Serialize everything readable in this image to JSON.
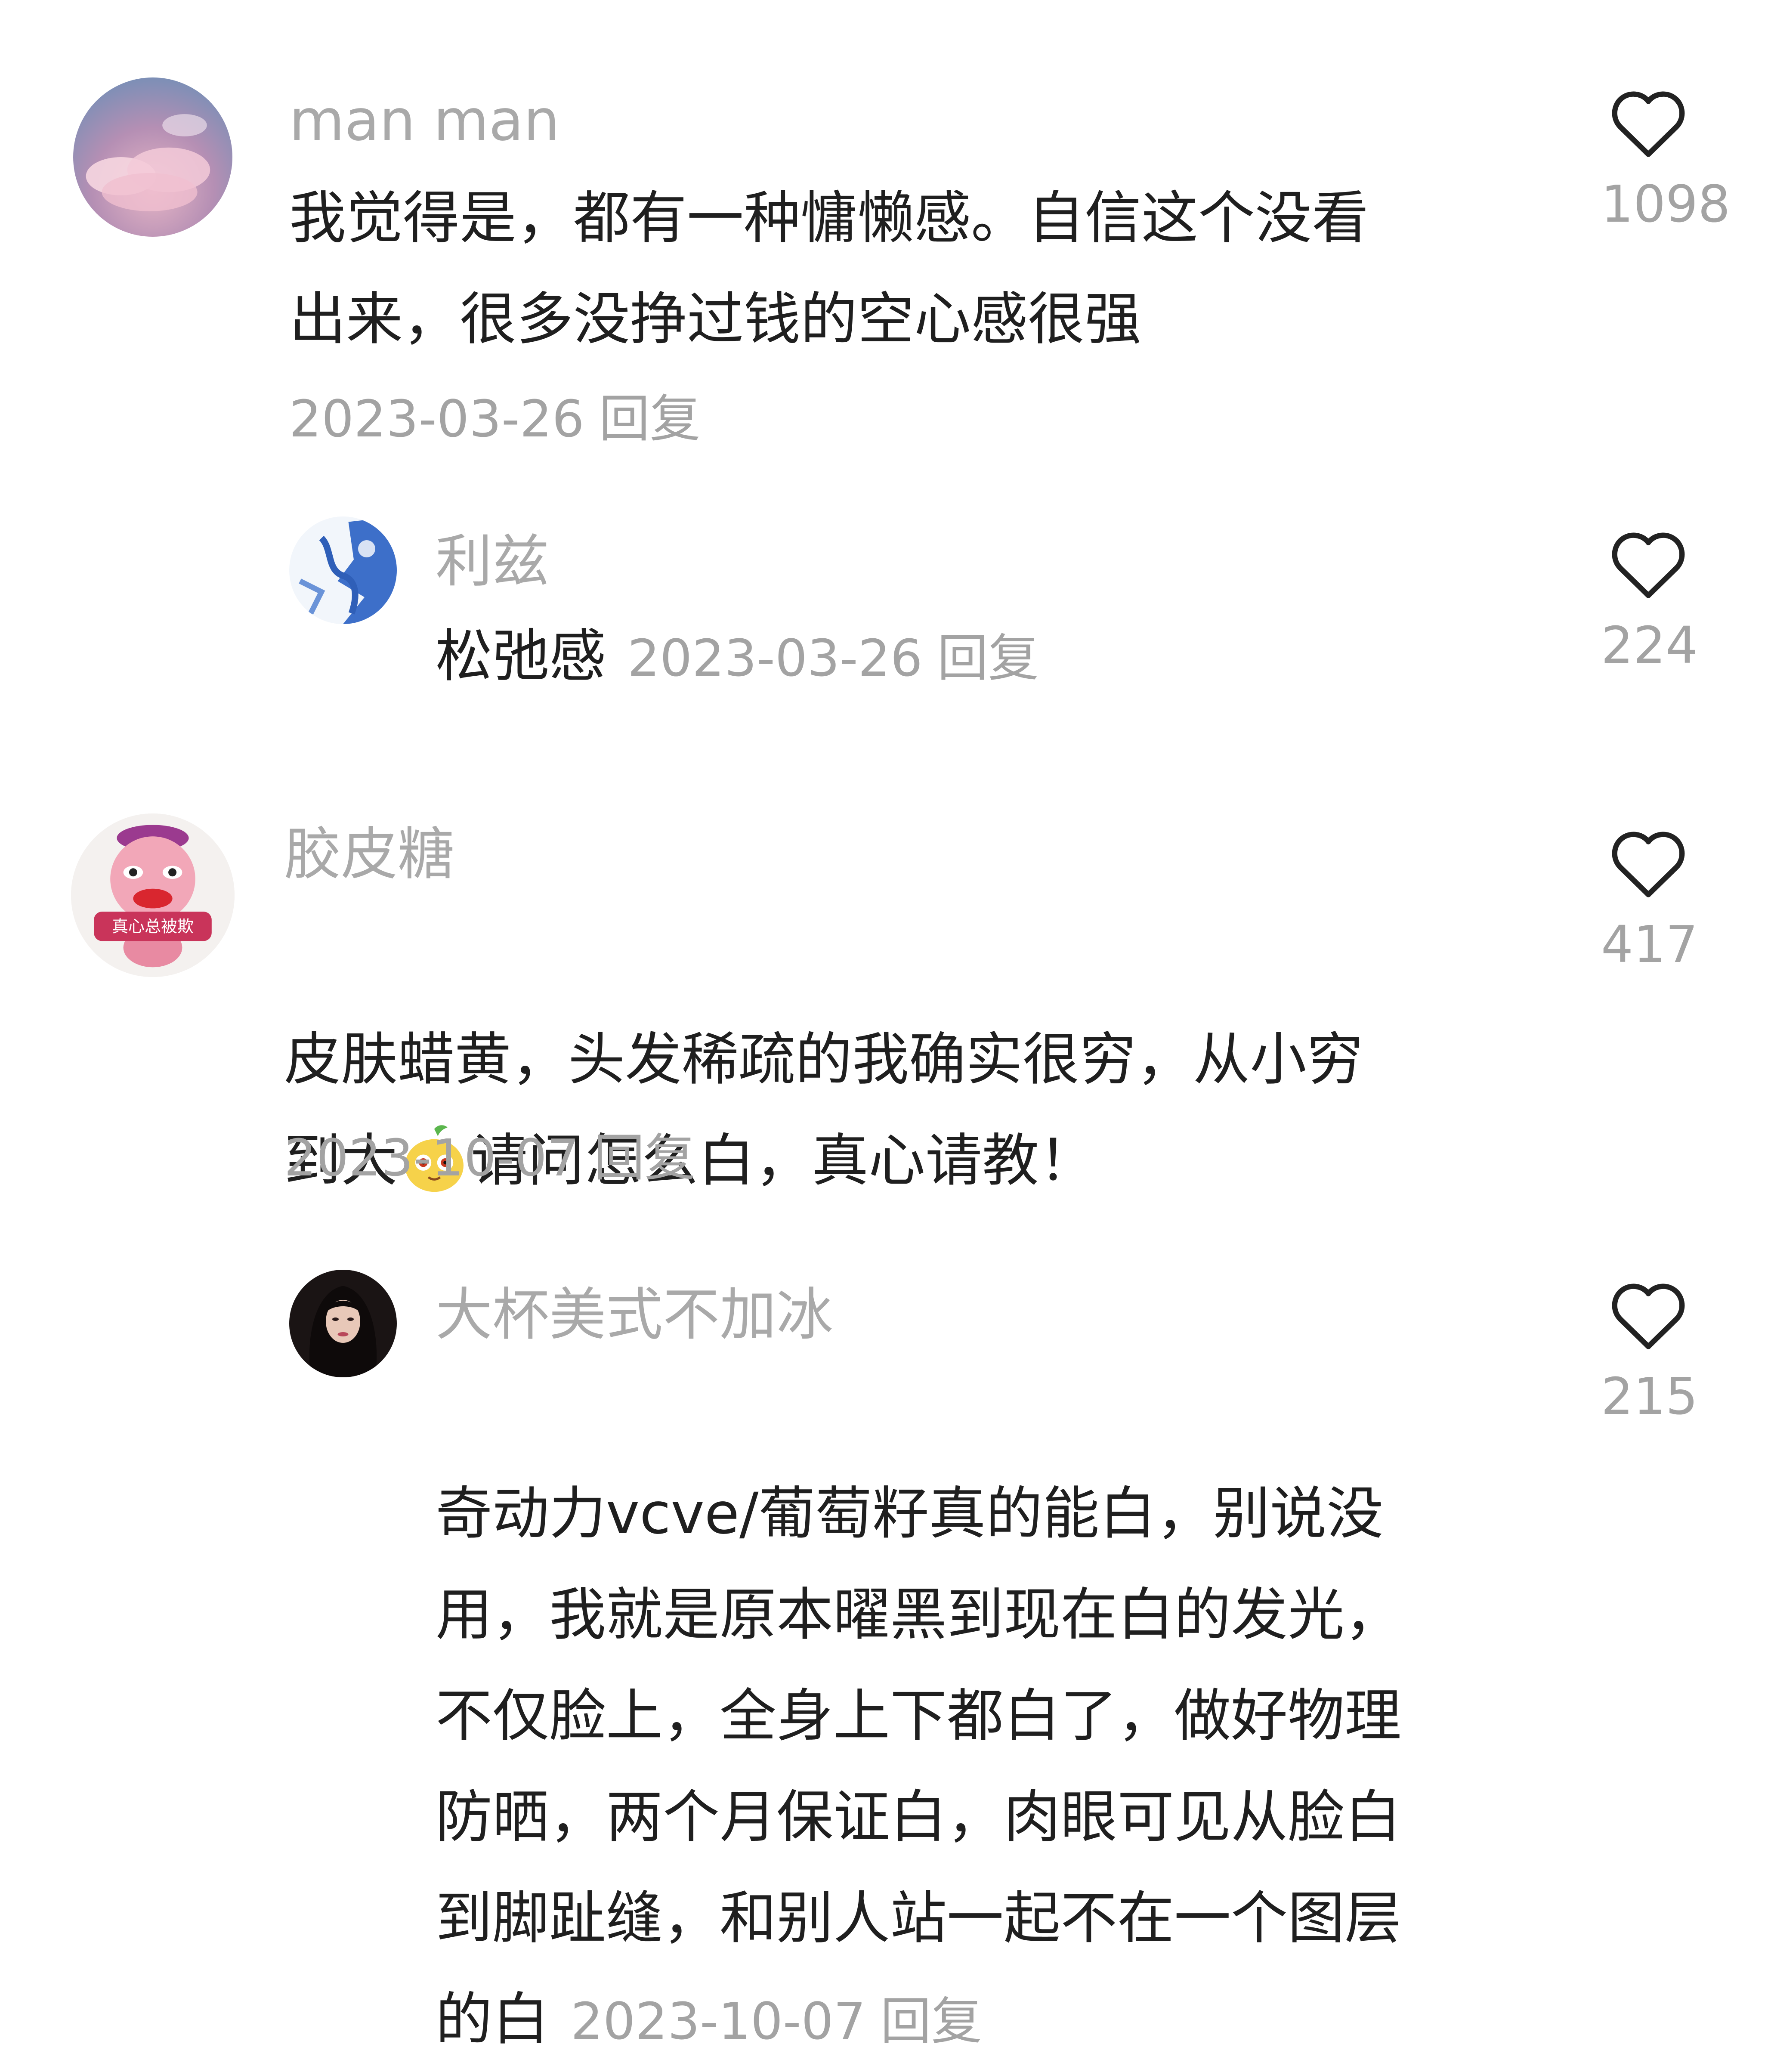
{
  "comments": [
    {
      "username": "man man",
      "text": "我觉得是，都有一种慵懒感。自信这个没看\n出来，很多没挣过钱的空心感很强",
      "date": "2023-03-26",
      "reply_label": "回复",
      "likes": "1098",
      "avatar_icon": "cloud-sky-avatar",
      "replies": [
        {
          "username": "利兹",
          "text": "松弛感",
          "date": "2023-03-26",
          "reply_label": "回复",
          "likes": "224",
          "avatar_icon": "blue-illustration-avatar"
        }
      ]
    },
    {
      "username": "胶皮糖",
      "text_part1": "皮肤蜡黄，头发稀疏的我确实很穷，从小穷\n到大",
      "emoji": "pear-emoji",
      "text_part2": "请问怎么白，真心请教！",
      "date": "2023-10-07",
      "reply_label": "回复",
      "likes": "417",
      "avatar_icon": "pink-pig-avatar",
      "avatar_caption": "真心总被欺",
      "replies": [
        {
          "username": "大杯美式不加冰",
          "text": "奇动力vcve/葡萄籽真的能白，别说没\n用，我就是原本曜黑到现在白的发光，\n不仅脸上，全身上下都白了，做好物理\n防晒，两个月保证白，肉眼可见从脸白\n到脚趾缝，和别人站一起不在一个图层\n的白",
          "date": "2023-10-07",
          "reply_label": "回复",
          "likes": "215",
          "avatar_icon": "woman-portrait-avatar"
        }
      ]
    }
  ],
  "colors": {
    "username": "#a9a9a9",
    "text": "#1f1f1f",
    "meta": "#a3a3a3",
    "heart_stroke": "#222222"
  }
}
